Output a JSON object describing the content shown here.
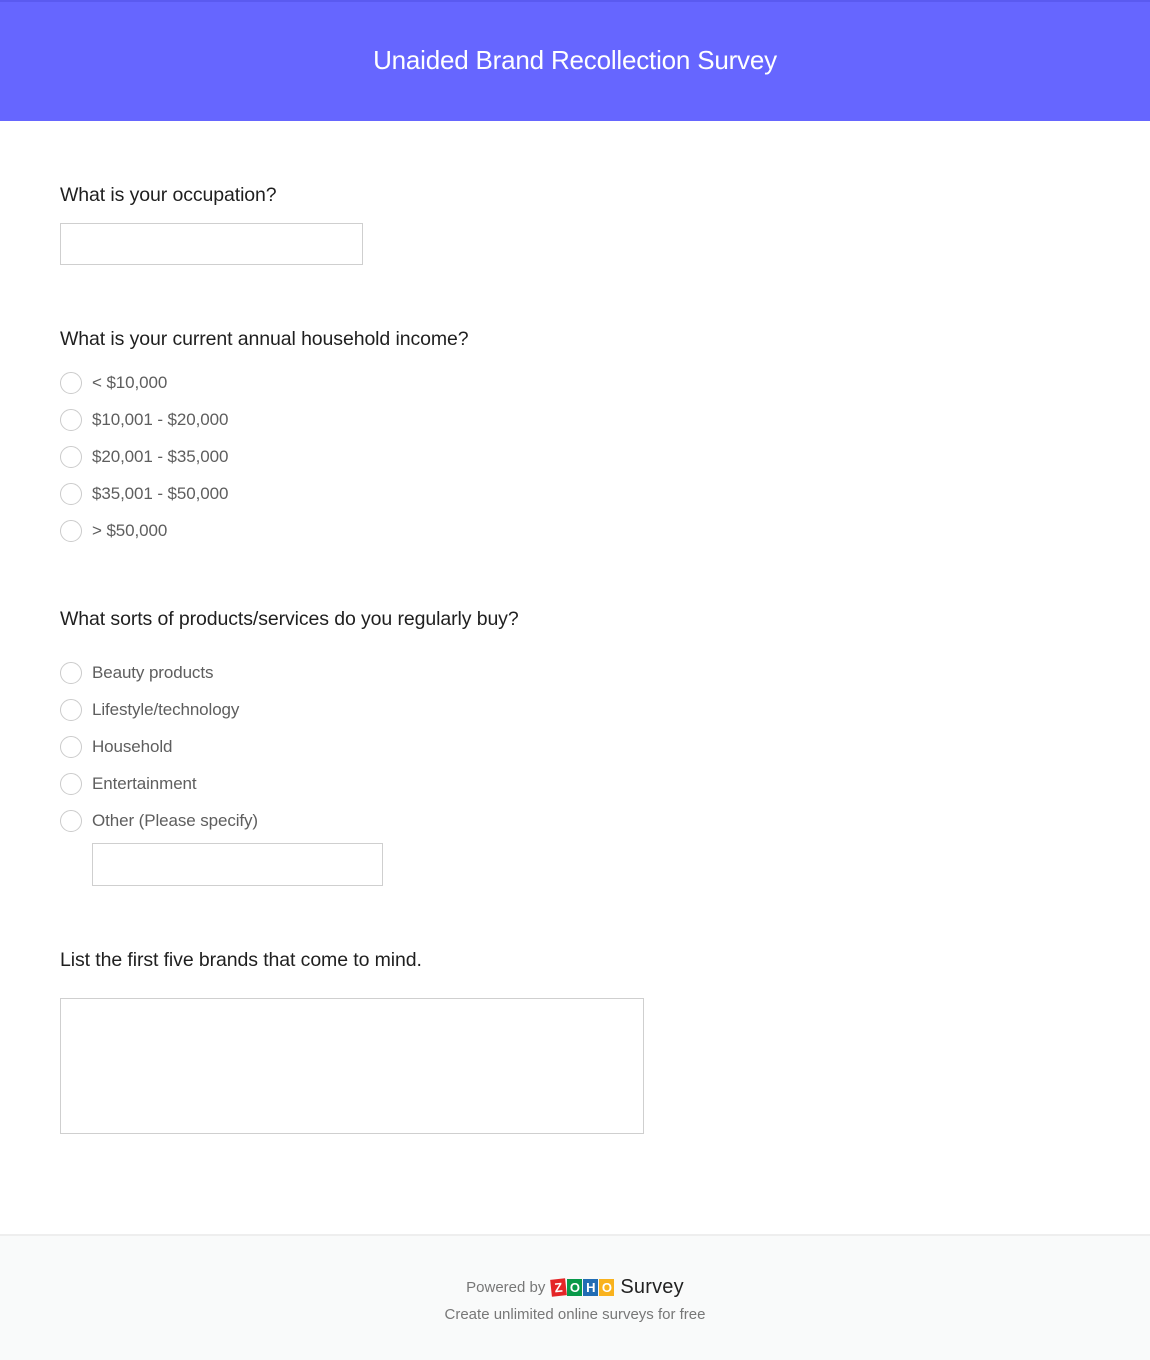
{
  "header": {
    "title": "Unaided Brand Recollection Survey",
    "background_color": "#6666ff"
  },
  "questions": {
    "occupation": {
      "title": "What is your occupation?",
      "value": "",
      "placeholder": ""
    },
    "income": {
      "title": "What is your current annual household income?",
      "options": [
        "< $10,000",
        "$10,001 - $20,000",
        "$20,001 - $35,000",
        "$35,001 - $50,000",
        "> $50,000"
      ]
    },
    "products": {
      "title": "What sorts of products/services do you regularly buy?",
      "options": [
        "Beauty products",
        "Lifestyle/technology",
        "Household",
        "Entertainment",
        "Other (Please specify)"
      ],
      "other_value": ""
    },
    "brands": {
      "title": "List the first five brands that come to mind.",
      "value": ""
    }
  },
  "footer": {
    "powered_by": "Powered by",
    "logo_letters": [
      "Z",
      "O",
      "H",
      "O"
    ],
    "product_name": "Survey",
    "tagline": "Create unlimited online surveys for free"
  }
}
